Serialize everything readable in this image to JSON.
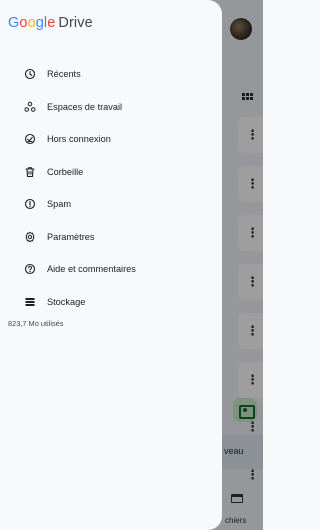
{
  "brand": {
    "letters": [
      "G",
      "o",
      "o",
      "g",
      "l",
      "e"
    ],
    "product": "Drive",
    "colors": {
      "blue": "#4285f4",
      "red": "#ea4335",
      "yellow": "#fbbc05",
      "green": "#34a853"
    }
  },
  "drawer": {
    "items": [
      {
        "label": "Récents",
        "icon": "clock-icon"
      },
      {
        "label": "Espaces de travail",
        "icon": "workspaces-icon"
      },
      {
        "label": "Hors connexion",
        "icon": "offline-icon"
      },
      {
        "label": "Corbeille",
        "icon": "trash-icon"
      },
      {
        "label": "Spam",
        "icon": "spam-icon"
      },
      {
        "label": "Paramètres",
        "icon": "settings-icon"
      },
      {
        "label": "Aide et commentaires",
        "icon": "help-icon"
      },
      {
        "label": "Stockage",
        "icon": "storage-icon"
      }
    ],
    "storage_used": "823,7 Mo utilisés"
  },
  "background": {
    "new_button_fragment": "veau",
    "nav_fragment": "chiers"
  }
}
